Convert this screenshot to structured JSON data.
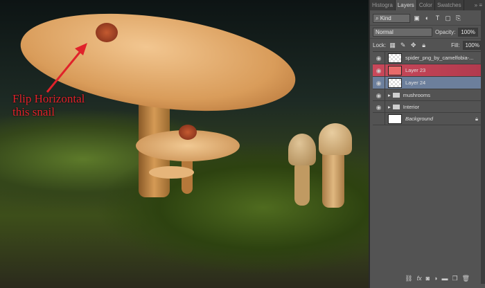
{
  "annotation": {
    "line1": "Flip Horizontal",
    "line2": "this snail",
    "color": "#e0222a"
  },
  "panel": {
    "tabs": [
      {
        "label": "Histogra"
      },
      {
        "label": "Layers"
      },
      {
        "label": "Color"
      },
      {
        "label": "Swatches"
      }
    ],
    "filter": {
      "value": "Kind"
    },
    "blend_mode": "Normal",
    "opacity_label": "Opacity:",
    "opacity": "100%",
    "lock_label": "Lock:",
    "fill_label": "Fill:",
    "fill": "100%",
    "layers": [
      {
        "name": "spider_png_by_camelfobia-...",
        "visible": true
      },
      {
        "name": "Layer 23",
        "visible": true
      },
      {
        "name": "Layer 24",
        "visible": true
      },
      {
        "name": "mushrooms",
        "visible": true,
        "group": true
      },
      {
        "name": "Interior",
        "visible": true,
        "group": true
      },
      {
        "name": "Background",
        "visible": false
      }
    ]
  }
}
